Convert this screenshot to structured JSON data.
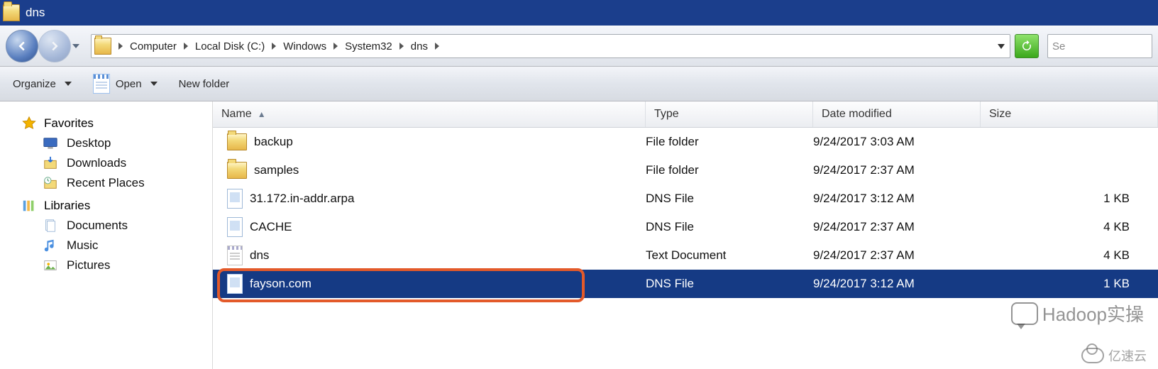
{
  "window": {
    "title": "dns"
  },
  "breadcrumbs": [
    "Computer",
    "Local Disk (C:)",
    "Windows",
    "System32",
    "dns"
  ],
  "search": {
    "placeholder": "Se"
  },
  "toolbar": {
    "organize": "Organize",
    "open": "Open",
    "new_folder": "New folder"
  },
  "sidebar": {
    "favorites": {
      "label": "Favorites",
      "items": [
        {
          "label": "Desktop"
        },
        {
          "label": "Downloads"
        },
        {
          "label": "Recent Places"
        }
      ]
    },
    "libraries": {
      "label": "Libraries",
      "items": [
        {
          "label": "Documents"
        },
        {
          "label": "Music"
        },
        {
          "label": "Pictures"
        }
      ]
    }
  },
  "columns": {
    "name": "Name",
    "type": "Type",
    "date": "Date modified",
    "size": "Size"
  },
  "files": [
    {
      "name": "backup",
      "type": "File folder",
      "date": "9/24/2017 3:03 AM",
      "size": "",
      "icon": "folder",
      "selected": false
    },
    {
      "name": "samples",
      "type": "File folder",
      "date": "9/24/2017 2:37 AM",
      "size": "",
      "icon": "folder",
      "selected": false
    },
    {
      "name": "31.172.in-addr.arpa",
      "type": "DNS File",
      "date": "9/24/2017 3:12 AM",
      "size": "1 KB",
      "icon": "file",
      "selected": false
    },
    {
      "name": "CACHE",
      "type": "DNS File",
      "date": "9/24/2017 2:37 AM",
      "size": "4 KB",
      "icon": "file",
      "selected": false
    },
    {
      "name": "dns",
      "type": "Text Document",
      "date": "9/24/2017 2:37 AM",
      "size": "4 KB",
      "icon": "txt",
      "selected": false
    },
    {
      "name": "fayson.com",
      "type": "DNS File",
      "date": "9/24/2017 3:12 AM",
      "size": "1 KB",
      "icon": "file",
      "selected": true
    }
  ],
  "watermarks": {
    "main": "Hadoop实操",
    "corner": "亿速云"
  }
}
